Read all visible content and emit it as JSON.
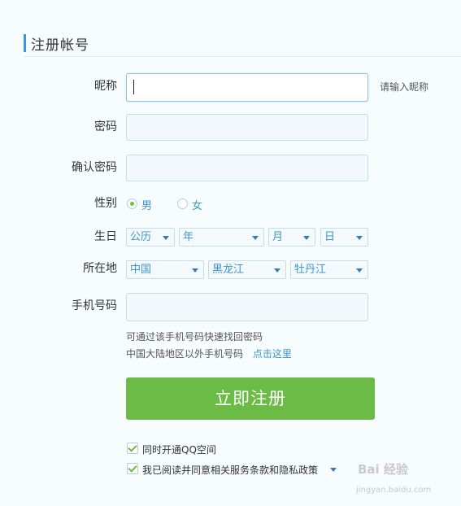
{
  "header": {
    "title": "注册帐号"
  },
  "form": {
    "nickname": {
      "label": "昵称",
      "value": "",
      "hint": "请输入昵称"
    },
    "password": {
      "label": "密码",
      "value": ""
    },
    "confirm_password": {
      "label": "确认密码",
      "value": ""
    },
    "gender": {
      "label": "性别",
      "options": [
        "男",
        "女"
      ],
      "selected": "男"
    },
    "birthday": {
      "label": "生日",
      "calendar": "公历",
      "year": "年",
      "month": "月",
      "day": "日"
    },
    "location": {
      "label": "所在地",
      "country": "中国",
      "province": "黑龙江",
      "city": "牡丹江"
    },
    "phone": {
      "label": "手机号码",
      "value": "",
      "note1": "可通过该手机号码快速找回密码",
      "note2_prefix": "中国大陆地区以外手机号码",
      "note2_link": "点击这里"
    },
    "submit_label": "立即注册",
    "checks": [
      {
        "label": "同时开通QQ空间",
        "checked": true
      },
      {
        "label": "我已阅读并同意相关服务条款和隐私政策",
        "checked": true
      }
    ]
  },
  "watermark": {
    "text": "Bai 经验",
    "sub": "jingyan.baidu.com"
  },
  "colors": {
    "accent": "#3c96dc",
    "button": "#6bbb46",
    "link": "#3d95cf"
  }
}
